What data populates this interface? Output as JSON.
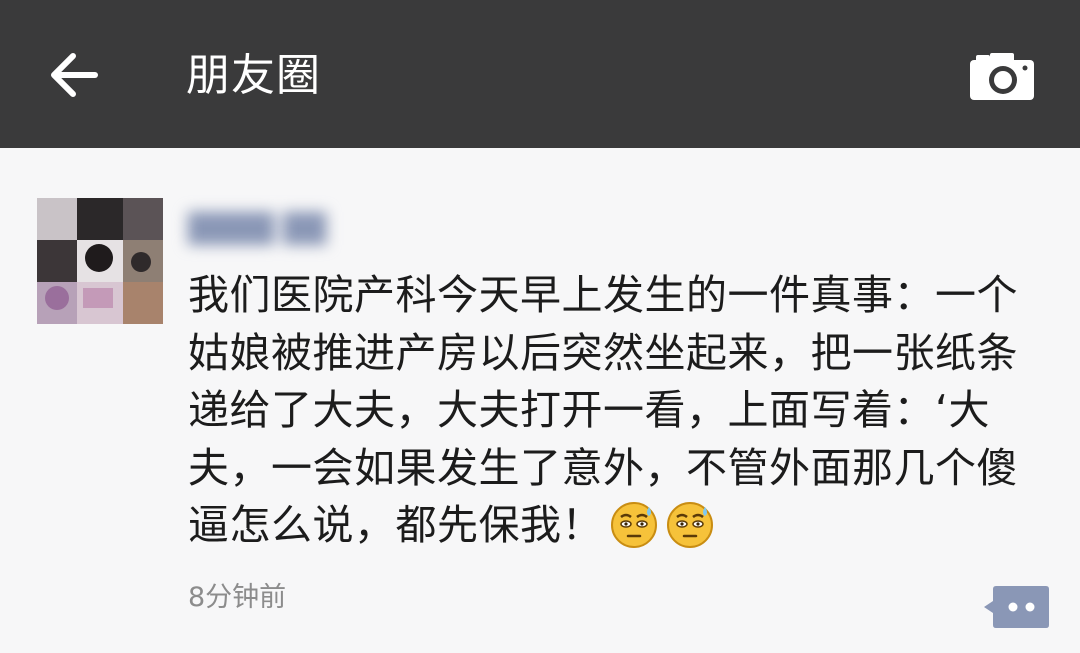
{
  "header": {
    "title": "朋友圈",
    "back_icon": "back-arrow-icon",
    "camera_icon": "camera-icon",
    "background": "#3a3a3b"
  },
  "post": {
    "author": "████ ██",
    "text": "我们医院产科今天早上发生的一件真事：一个姑娘被推进产房以后突然坐起来，把一张纸条递给了大夫，大夫打开一看，上面写着：‘大夫，一会如果发生了意外，不管外面那几个傻逼怎么说，都先保我！",
    "emojis": [
      "sweat-emoji",
      "sweat-emoji"
    ],
    "timestamp": "8分钟前",
    "comment_icon": "comment-bubble-icon",
    "accent": "#8a97b6"
  }
}
